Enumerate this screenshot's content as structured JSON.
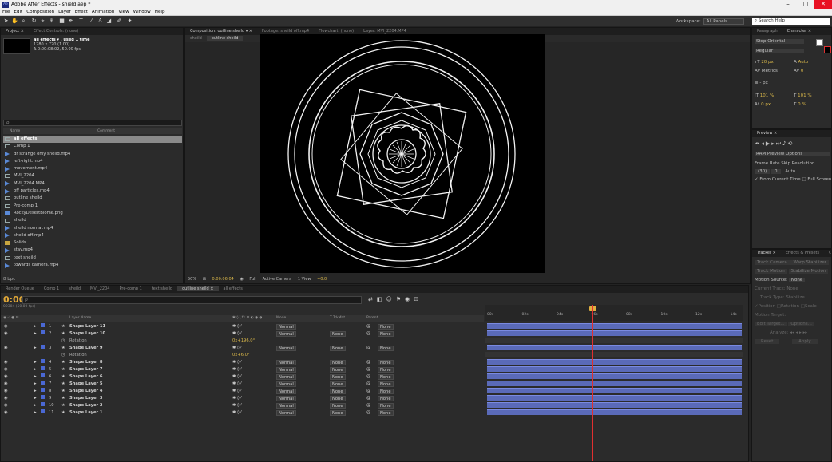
{
  "window": {
    "title": "Adobe After Effects - shield.aep *",
    "app_badge": "Ae",
    "controls": [
      "–",
      "□",
      "✕"
    ]
  },
  "menu": [
    "File",
    "Edit",
    "Composition",
    "Layer",
    "Effect",
    "Animation",
    "View",
    "Window",
    "Help"
  ],
  "toolbar": {
    "workspace_label": "Workspace:",
    "workspace_value": "All Panels",
    "search_help": "Search Help"
  },
  "project_panel": {
    "tabs": [
      "Project ×",
      "Effect Controls: (none)"
    ],
    "info": [
      "all effects ▾ , used 1 time",
      "1280 x 720 (1.00)",
      "Δ 0:00:08:02, 50.00 fps"
    ],
    "search_placeholder": "",
    "columns": {
      "name": "Name",
      "comment": "Comment"
    },
    "items": [
      {
        "name": "all effects",
        "icon": "comp",
        "selected": true
      },
      {
        "name": "Comp 1",
        "icon": "comp"
      },
      {
        "name": "dr strange only sheild.mp4",
        "icon": "video"
      },
      {
        "name": "left-right.mp4",
        "icon": "video"
      },
      {
        "name": "movement.mp4",
        "icon": "video"
      },
      {
        "name": "MVI_2204",
        "icon": "comp"
      },
      {
        "name": "MVI_2204.MP4",
        "icon": "video"
      },
      {
        "name": "off particles.mp4",
        "icon": "video"
      },
      {
        "name": "outline sheild",
        "icon": "comp"
      },
      {
        "name": "Pre-comp 1",
        "icon": "comp"
      },
      {
        "name": "RockyDesertBiome.png",
        "icon": "image"
      },
      {
        "name": "sheild",
        "icon": "comp"
      },
      {
        "name": "sheild normal.mp4",
        "icon": "video"
      },
      {
        "name": "sheild off.mp4",
        "icon": "video"
      },
      {
        "name": "Solids",
        "icon": "folder"
      },
      {
        "name": "stay.mp4",
        "icon": "video"
      },
      {
        "name": "text sheild",
        "icon": "comp"
      },
      {
        "name": "towards camera.mp4",
        "icon": "video"
      }
    ],
    "bpc": "8 bpc"
  },
  "composition_panel": {
    "tabs": [
      "Composition: outline sheild ▾ ×",
      "Footage: sheild off.mp4",
      "Flowchart: (none)",
      "Layer: MVI_2204.MP4"
    ],
    "subtabs": [
      "sheild",
      "outline sheild"
    ],
    "viewer_bar": {
      "zoom": "50%",
      "time": "0:00:06:04",
      "resolution": "Full",
      "camera": "Active Camera",
      "view": "1 View",
      "exposure": "+0.0"
    }
  },
  "right_panel": {
    "tabs_top": [
      "Paragraph",
      "Character ×"
    ],
    "font": "Stop Oriental",
    "style": "Regular",
    "size": "20 px",
    "leading": "Auto",
    "kerning": "Metrics",
    "tracking": "0",
    "stroke": "- px",
    "vscale": "101 %",
    "hscale": "101 %",
    "baseline": "0 px",
    "tsume": "0 %",
    "preview_tab": "Preview ×",
    "ram_options": "RAM Preview Options",
    "frame_rate_label": "Frame Rate",
    "skip_label": "Skip",
    "resolution_label": "Resolution",
    "frame_rate": "(30)",
    "skip": "0",
    "resolution": "Auto",
    "from_current": "From Current Time",
    "full_screen": "Full Screen",
    "tracker_tabs": [
      "Tracker ×",
      "Effects & Presets",
      "Ca"
    ],
    "tracker_buttons": [
      "Track Camera",
      "Warp Stabilizer",
      "Track Motion",
      "Stabilize Motion"
    ],
    "motion_source_label": "Motion Source:",
    "motion_source": "None",
    "current_track": "Current Track:",
    "current_track_value": "None",
    "track_type": "Track Type:",
    "track_type_value": "Stabilize",
    "position": "Position",
    "rotation": "Rotation",
    "scale": "Scale",
    "motion_target": "Motion Target:",
    "edit_target": "Edit Target...",
    "options": "Options...",
    "analyze": "Analyze:",
    "reset": "Reset",
    "apply": "Apply"
  },
  "timeline": {
    "tabs": [
      "Render Queue",
      "Comp 1",
      "sheild",
      "MVI_2204",
      "Pre-comp 1",
      "text sheild",
      "outline sheild ×",
      "all effects"
    ],
    "time": "0:00:06:04",
    "fps": "00304 (50.00 fps)",
    "search_placeholder": "ρ",
    "columns": {
      "layer_name": "Layer Name",
      "mode": "Mode",
      "trkmat": "T TrkMat",
      "parent": "Parent"
    },
    "ruler_labels": [
      "00s",
      "02s",
      "04s",
      "06s",
      "08s",
      "10s",
      "12s",
      "14s"
    ],
    "layers": [
      {
        "num": "1",
        "name": "Shape Layer 11",
        "mode": "Normal",
        "trkmat": "",
        "parent": "None"
      },
      {
        "num": "2",
        "name": "Shape Layer 10",
        "mode": "Normal",
        "trkmat": "None",
        "parent": "None"
      },
      {
        "sub": true,
        "name": "Rotation",
        "value": "0x+196.0°"
      },
      {
        "num": "3",
        "name": "Shape Layer 9",
        "mode": "Normal",
        "trkmat": "None",
        "parent": "None"
      },
      {
        "sub": true,
        "name": "Rotation",
        "value": "0x+6.0°"
      },
      {
        "num": "4",
        "name": "Shape Layer 8",
        "mode": "Normal",
        "trkmat": "None",
        "parent": "None"
      },
      {
        "num": "5",
        "name": "Shape Layer 7",
        "mode": "Normal",
        "trkmat": "None",
        "parent": "None"
      },
      {
        "num": "6",
        "name": "Shape Layer 6",
        "mode": "Normal",
        "trkmat": "None",
        "parent": "None"
      },
      {
        "num": "7",
        "name": "Shape Layer 5",
        "mode": "Normal",
        "trkmat": "None",
        "parent": "None"
      },
      {
        "num": "8",
        "name": "Shape Layer 4",
        "mode": "Normal",
        "trkmat": "None",
        "parent": "None"
      },
      {
        "num": "9",
        "name": "Shape Layer 3",
        "mode": "Normal",
        "trkmat": "None",
        "parent": "None"
      },
      {
        "num": "10",
        "name": "Shape Layer 2",
        "mode": "Normal",
        "trkmat": "None",
        "parent": "None"
      },
      {
        "num": "11",
        "name": "Shape Layer 1",
        "mode": "Normal",
        "trkmat": "None",
        "parent": "None"
      }
    ]
  },
  "colors": {
    "timecode": "#e0a838",
    "layer_bar": "#5a6ab8",
    "label_blue": "#4a68d4",
    "cti": "#e03030",
    "close": "#e81123"
  }
}
